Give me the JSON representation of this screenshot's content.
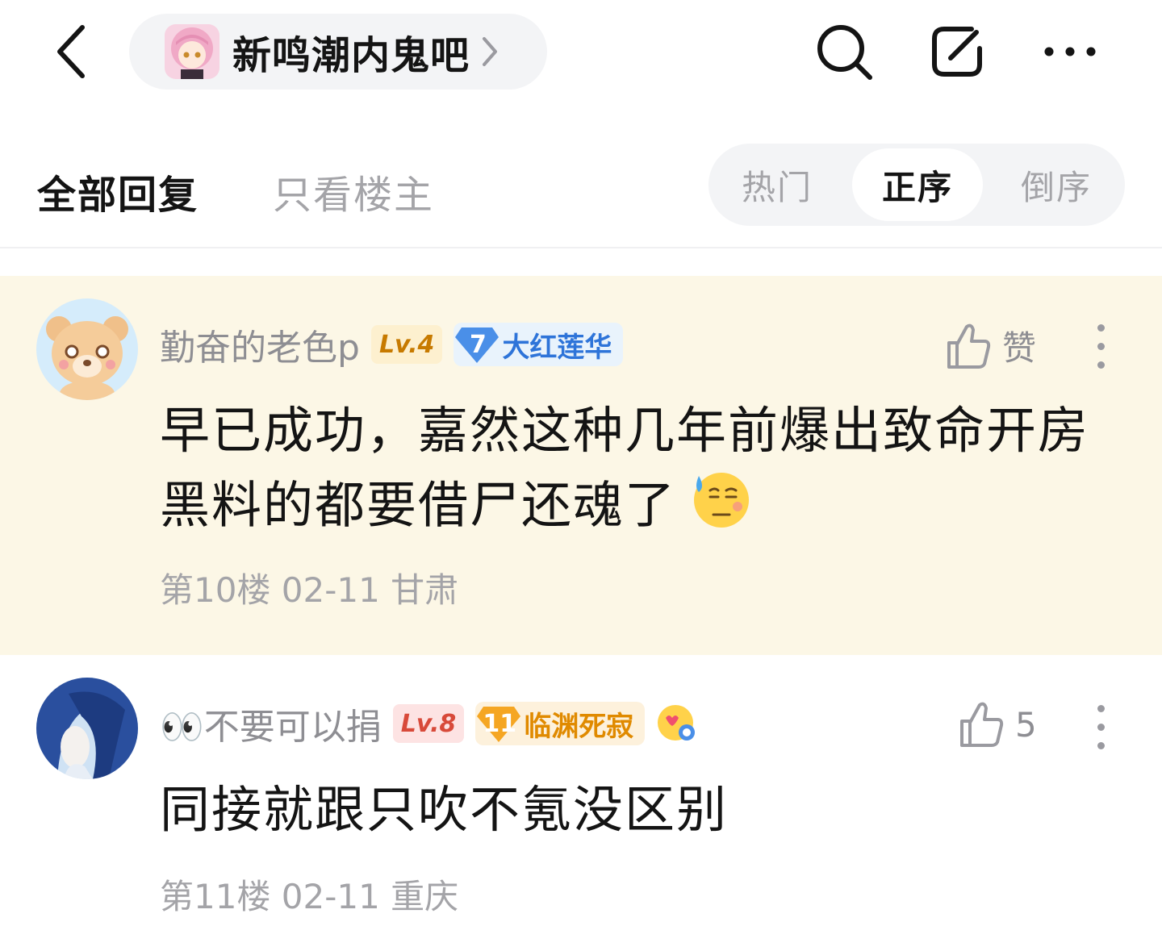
{
  "header": {
    "back_icon": "chevron-left-icon",
    "forum_name": "新鸣潮内鬼吧",
    "forum_chevron_icon": "chevron-right-icon",
    "search_icon": "search-icon",
    "share_icon": "share-icon",
    "more_icon": "more-horizontal-icon"
  },
  "tabs": {
    "all_replies": "全部回复",
    "only_op": "只看楼主",
    "sort": [
      {
        "label": "热门",
        "active": false
      },
      {
        "label": "正序",
        "active": true
      },
      {
        "label": "倒序",
        "active": false
      }
    ]
  },
  "posts": [
    {
      "username": "勤奋的老色p",
      "level": "Lv.4",
      "level_bg": "#fdf0cf",
      "level_color": "#c77a00",
      "badge_number": "7",
      "badge_title": "大红莲华",
      "badge_bg": "#e9f3fc",
      "badge_color": "#2e74d9",
      "like_label": "赞",
      "content": "早已成功，嘉然这种几年前爆出致命开房黑料的都要借尸还魂了",
      "emoji": "sweat-smile-emoji",
      "meta": "第10楼 02-11 甘肃",
      "highlighted": true
    },
    {
      "username": "👀不要可以捐",
      "level": "Lv.8",
      "level_bg": "#fde3e3",
      "level_color": "#d84a3a",
      "badge_number": "11",
      "badge_title": "临渊死寂",
      "badge_bg": "#fdf1dc",
      "badge_color": "#e08a00",
      "extra_icon": "heart-face-icon",
      "like_label": "5",
      "content": "同接就跟只吹不氪没区别",
      "meta": "第11楼 02-11 重庆",
      "highlighted": false
    }
  ]
}
